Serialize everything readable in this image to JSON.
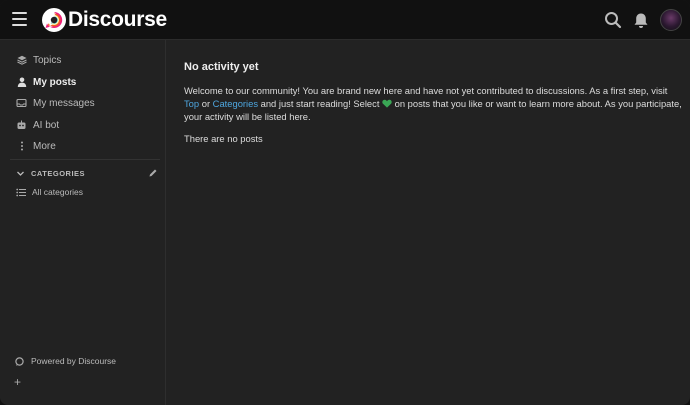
{
  "header": {
    "logo_text": "Discourse",
    "icons": [
      "menu-icon",
      "search-icon",
      "bell-icon",
      "avatar"
    ]
  },
  "sidebar": {
    "items": [
      {
        "label": "Topics",
        "icon": "layers-icon"
      },
      {
        "label": "My posts",
        "icon": "user-icon",
        "active": true
      },
      {
        "label": "My messages",
        "icon": "inbox-icon"
      },
      {
        "label": "AI bot",
        "icon": "robot-icon"
      },
      {
        "label": "More",
        "icon": "ellipsis-vertical-icon"
      }
    ],
    "categories_label": "CATEGORIES",
    "all_categories_label": "All categories",
    "powered_by": "Powered by Discourse",
    "add_label": "+"
  },
  "main": {
    "title": "No activity yet",
    "para_part1": "Welcome to our community! You are brand new here and have not yet contributed to discussions. As a first step, visit ",
    "link_top": "Top",
    "para_or": " or ",
    "link_categories": "Categories",
    "para_part2": " and just start reading! Select ",
    "para_part3": " on posts that you like or want to learn more about. As you participate, your activity will be listed here.",
    "no_posts": "There are no posts"
  },
  "colors": {
    "background": "#222222",
    "header": "#111111",
    "link": "#4ea6df",
    "heart": "#3aa655"
  }
}
